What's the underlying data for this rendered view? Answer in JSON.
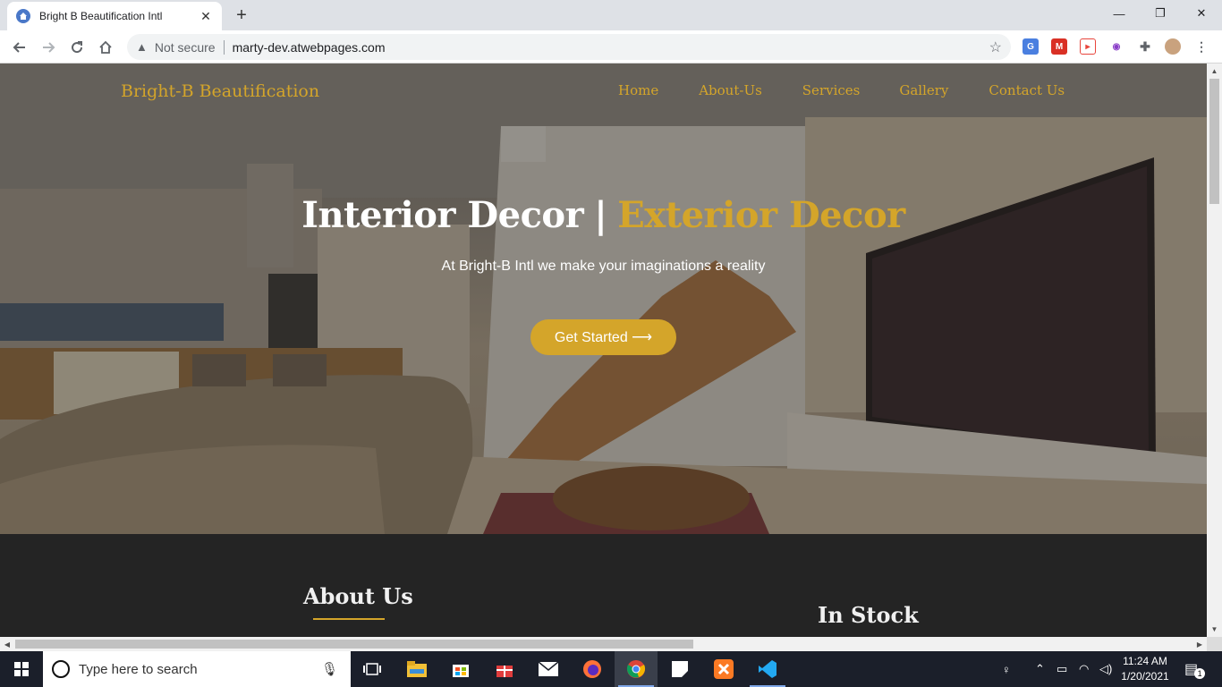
{
  "browser": {
    "tab_title": "Bright B Beautification Intl",
    "security_label": "Not secure",
    "url": "marty-dev.atwebpages.com"
  },
  "site": {
    "logo": "Bright-B Beautification",
    "nav": [
      "Home",
      "About-Us",
      "Services",
      "Gallery",
      "Contact Us"
    ]
  },
  "hero": {
    "heading_main": "Interior Decor",
    "heading_separator": "|",
    "heading_accent": "Exterior Decor",
    "subtitle": "At Bright-B Intl we make your imaginations a reality",
    "cta_label": "Get Started ⟶"
  },
  "sections": {
    "about_title": "About Us",
    "stock_title": "In Stock"
  },
  "taskbar": {
    "search_placeholder": "Type here to search",
    "time": "11:24 AM",
    "date": "1/20/2021",
    "notification_count": "1"
  },
  "colors": {
    "accent": "#d4a52a",
    "dark_section": "#242424",
    "taskbar": "#1b1f2a"
  },
  "icons": [
    "back-icon",
    "forward-icon",
    "reload-icon",
    "home-icon",
    "warning-icon",
    "star-icon",
    "extensions-icon",
    "windows-start-icon",
    "search-icon",
    "mic-icon",
    "task-view-icon"
  ]
}
